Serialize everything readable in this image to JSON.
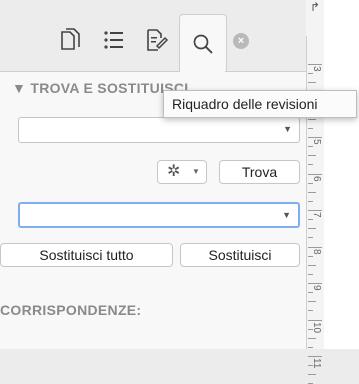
{
  "tabs": [
    {
      "name": "pages",
      "icon": "pages-icon"
    },
    {
      "name": "outline",
      "icon": "list-icon"
    },
    {
      "name": "review",
      "icon": "document-edit-icon"
    },
    {
      "name": "search",
      "icon": "search-icon",
      "selected": true
    }
  ],
  "close_symbol": "×",
  "section_title": "▼ TROVA E SOSTITUISCI",
  "tooltip": "Riquadro delle revisioni",
  "find": {
    "value": "",
    "dropdown_arrow": "▼"
  },
  "options_button": {
    "icon": "gear-icon",
    "caret": "▼"
  },
  "find_button": "Trova",
  "replace": {
    "value": "",
    "dropdown_arrow": "▼",
    "focused": true
  },
  "replace_all_button": "Sostituisci tutto",
  "replace_button": "Sostituisci",
  "matches_title": "CORRISPONDENZE:",
  "ruler": {
    "corner_symbol": "↱",
    "numbers": [
      "3",
      "4",
      "5",
      "6",
      "7",
      "8",
      "9",
      "10",
      "11"
    ]
  },
  "colors": {
    "focus_ring": "#7eaef0",
    "panel_bg": "#f8f8f8",
    "bar_bg": "#ececec"
  }
}
